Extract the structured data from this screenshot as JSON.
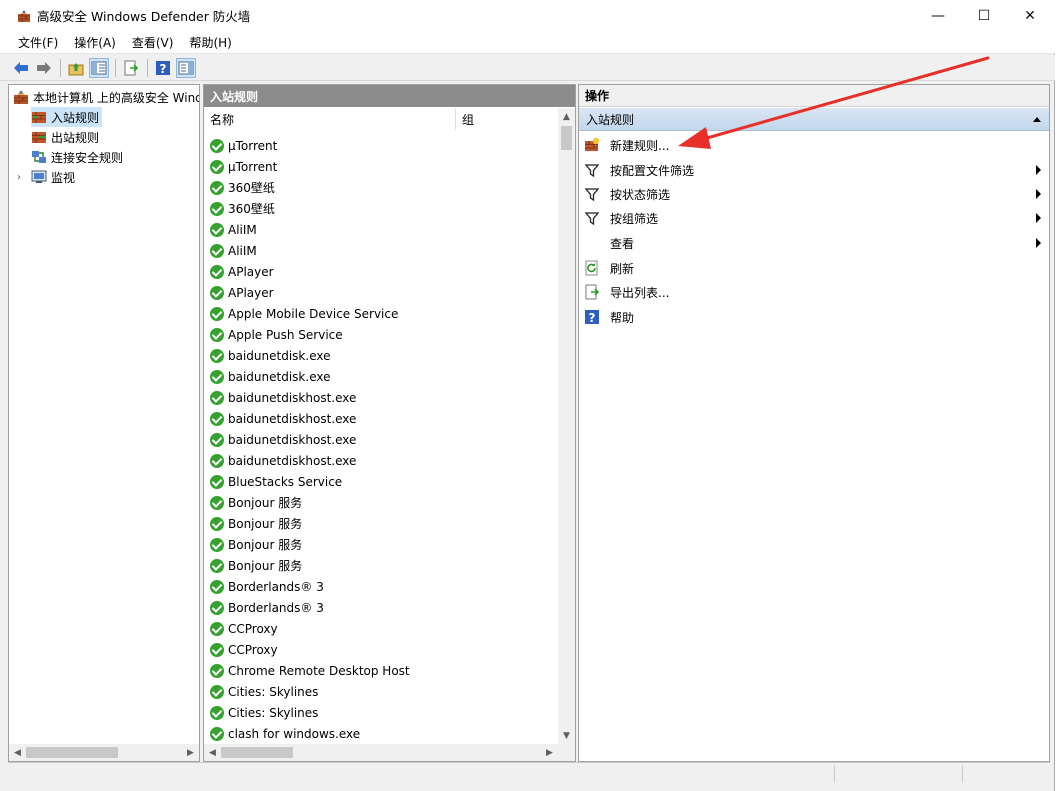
{
  "window": {
    "title": "高级安全 Windows Defender 防火墙",
    "controls": {
      "minimize": "—",
      "maximize": "☐",
      "close": "✕"
    }
  },
  "menu": [
    "文件(F)",
    "操作(A)",
    "查看(V)",
    "帮助(H)"
  ],
  "toolbar": [
    "back-icon",
    "forward-icon",
    "up-folder-icon",
    "show-tree-icon",
    "export-icon",
    "help-icon",
    "show-action-pane-icon"
  ],
  "tree": {
    "root": "本地计算机 上的高级安全 Windows Defender 防火墙",
    "items": [
      "入站规则",
      "出站规则",
      "连接安全规则",
      "监视"
    ],
    "selected": "入站规则"
  },
  "center": {
    "header": "入站规则",
    "columns": {
      "name": "名称",
      "group": "组"
    },
    "rules": [
      "µTorrent",
      "µTorrent",
      "360壁纸",
      "360壁纸",
      "AliIM",
      "AliIM",
      "APlayer",
      "APlayer",
      "Apple Mobile Device Service",
      "Apple Push Service",
      "baidunetdisk.exe",
      "baidunetdisk.exe",
      "baidunetdiskhost.exe",
      "baidunetdiskhost.exe",
      "baidunetdiskhost.exe",
      "baidunetdiskhost.exe",
      "BlueStacks Service",
      "Bonjour 服务",
      "Bonjour 服务",
      "Bonjour 服务",
      "Bonjour 服务",
      "Borderlands® 3",
      "Borderlands® 3",
      "CCProxy",
      "CCProxy",
      "Chrome Remote Desktop Host",
      "Cities: Skylines",
      "Cities: Skylines",
      "clash for windows.exe"
    ]
  },
  "actions": {
    "header": "操作",
    "section": "入站规则",
    "items": [
      {
        "label": "新建规则...",
        "icon": "new-rule-icon",
        "submenu": false
      },
      {
        "label": "按配置文件筛选",
        "icon": "filter-icon",
        "submenu": true
      },
      {
        "label": "按状态筛选",
        "icon": "filter-icon",
        "submenu": true
      },
      {
        "label": "按组筛选",
        "icon": "filter-icon",
        "submenu": true
      },
      {
        "label": "查看",
        "icon": "",
        "submenu": true
      },
      {
        "label": "刷新",
        "icon": "refresh-icon",
        "submenu": false
      },
      {
        "label": "导出列表...",
        "icon": "export-list-icon",
        "submenu": false
      },
      {
        "label": "帮助",
        "icon": "help-icon",
        "submenu": false
      }
    ]
  },
  "colors": {
    "check": "#35a12e",
    "header_gray": "#8c8c8c",
    "annotation_arrow": "#e8302a"
  }
}
